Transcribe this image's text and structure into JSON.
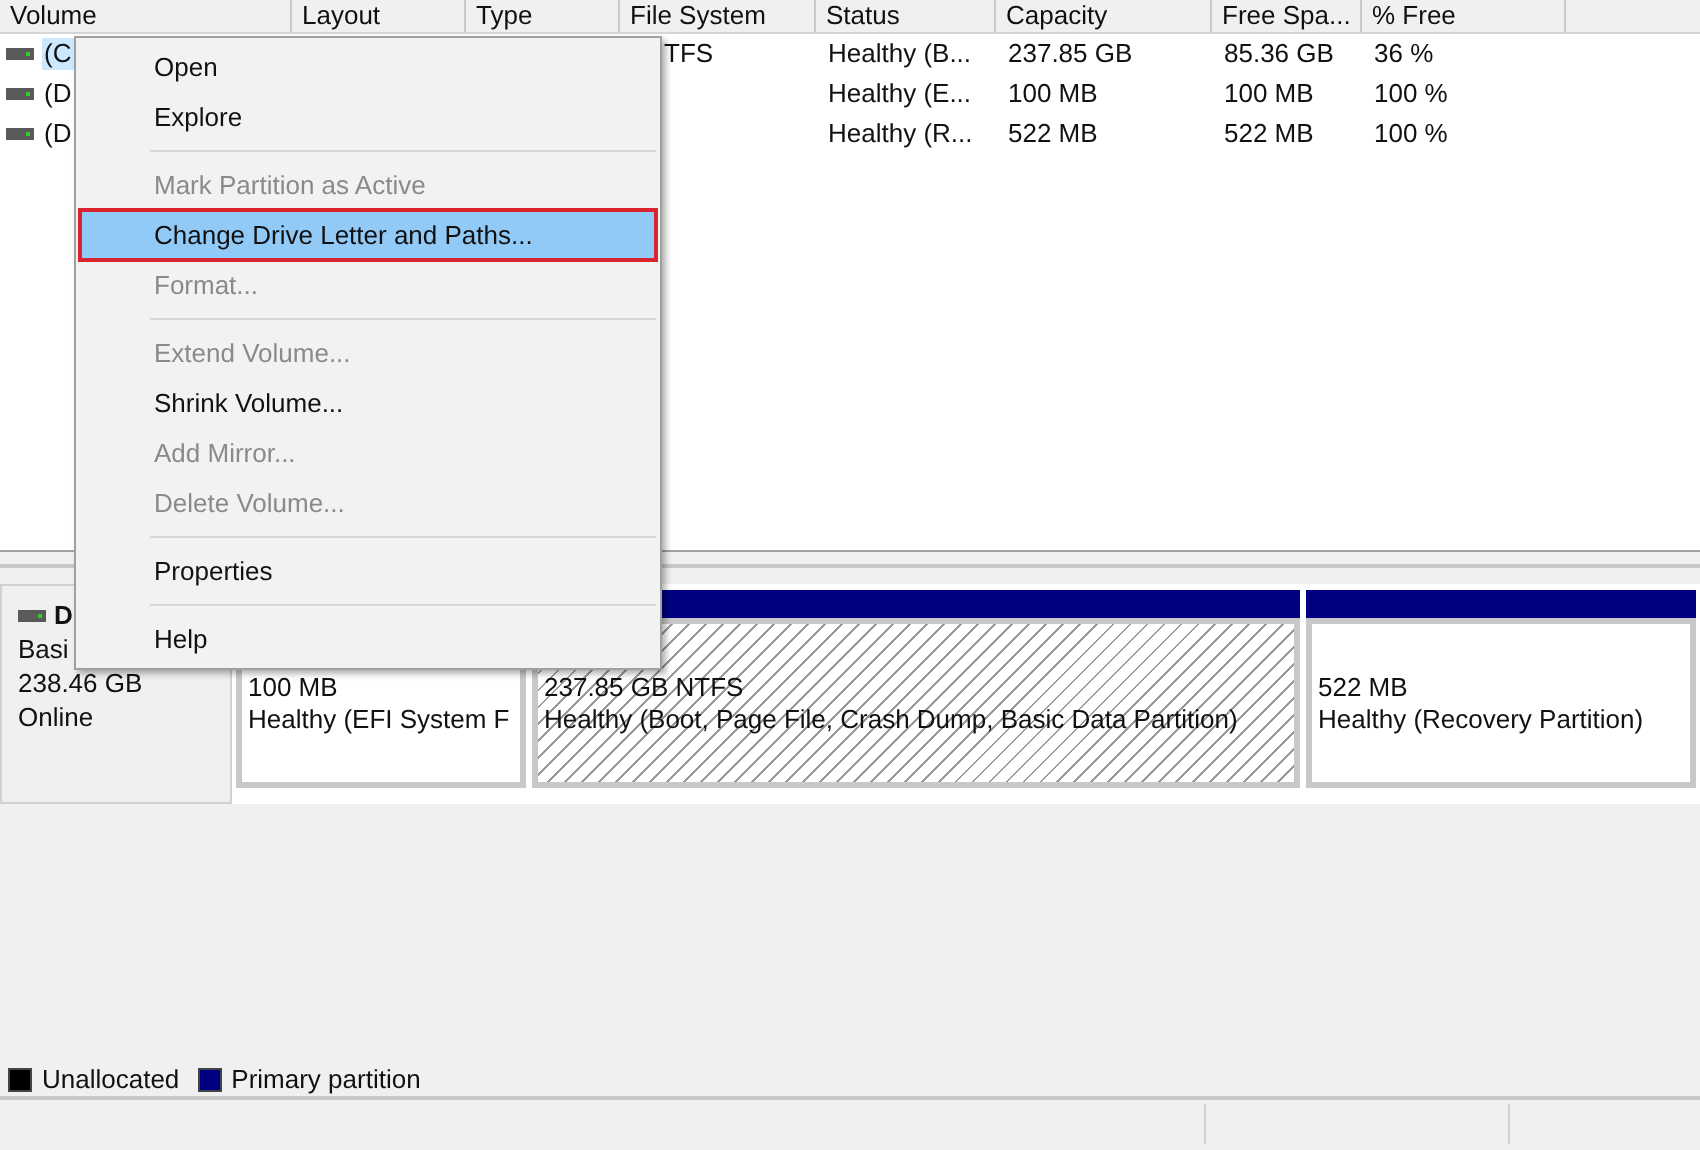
{
  "volume_list": {
    "columns": [
      "Volume",
      "Layout",
      "Type",
      "File System",
      "Status",
      "Capacity",
      "Free Spa...",
      "% Free"
    ],
    "rows": [
      {
        "selected": true,
        "cells": [
          "(C",
          "",
          "",
          "TFS",
          "Healthy (B...",
          "237.85 GB",
          "85.36 GB",
          "36 %"
        ]
      },
      {
        "selected": false,
        "cells": [
          "(D",
          "",
          "",
          "",
          "Healthy (E...",
          "100 MB",
          "100 MB",
          "100 %"
        ]
      },
      {
        "selected": false,
        "cells": [
          "(D",
          "",
          "",
          "",
          "Healthy (R...",
          "522 MB",
          "522 MB",
          "100 %"
        ]
      }
    ]
  },
  "disk": {
    "name": "D",
    "type": "Basi",
    "size": "238.46 GB",
    "state": "Online",
    "partitions": [
      {
        "selected": false,
        "size": "100 MB",
        "status": "Healthy (EFI System F"
      },
      {
        "selected": true,
        "size": "237.85 GB NTFS",
        "status": "Healthy (Boot, Page File, Crash Dump, Basic Data Partition)"
      },
      {
        "selected": false,
        "size": "522 MB",
        "status": "Healthy (Recovery Partition)"
      }
    ]
  },
  "legend": [
    {
      "label": "Unallocated",
      "color": "#000000"
    },
    {
      "label": "Primary partition",
      "color": "#000080"
    }
  ],
  "context_menu": [
    {
      "kind": "item",
      "label": "Open",
      "disabled": false,
      "selected": false
    },
    {
      "kind": "item",
      "label": "Explore",
      "disabled": false,
      "selected": false
    },
    {
      "kind": "separator"
    },
    {
      "kind": "item",
      "label": "Mark Partition as Active",
      "disabled": true,
      "selected": false
    },
    {
      "kind": "item",
      "label": "Change Drive Letter and Paths...",
      "disabled": false,
      "selected": true
    },
    {
      "kind": "item",
      "label": "Format...",
      "disabled": true,
      "selected": false
    },
    {
      "kind": "separator"
    },
    {
      "kind": "item",
      "label": "Extend Volume...",
      "disabled": true,
      "selected": false
    },
    {
      "kind": "item",
      "label": "Shrink Volume...",
      "disabled": false,
      "selected": false
    },
    {
      "kind": "item",
      "label": "Add Mirror...",
      "disabled": true,
      "selected": false
    },
    {
      "kind": "item",
      "label": "Delete Volume...",
      "disabled": true,
      "selected": false
    },
    {
      "kind": "separator"
    },
    {
      "kind": "item",
      "label": "Properties",
      "disabled": false,
      "selected": false
    },
    {
      "kind": "separator"
    },
    {
      "kind": "item",
      "label": "Help",
      "disabled": false,
      "selected": false
    }
  ]
}
